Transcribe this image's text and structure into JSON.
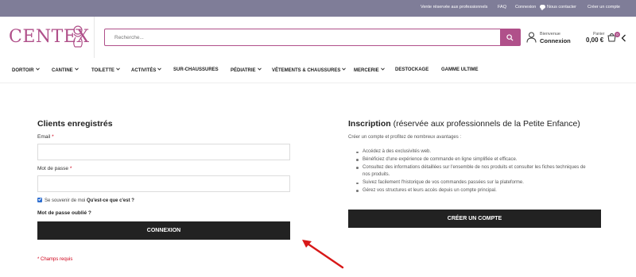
{
  "topbar": {
    "links": [
      "Vente réservée aux professionnels",
      "FAQ",
      "Connexion",
      "Nous contacter",
      "Créer un compte"
    ]
  },
  "header": {
    "logo_text": "CENTEX",
    "search_placeholder": "Recherche...",
    "user_greeting": "Bienvenue",
    "user_action": "Connexion",
    "cart_label": "Panier",
    "cart_total": "0,00 €",
    "cart_count": "0"
  },
  "nav": {
    "items": [
      "DORTOIR",
      "CANTINE",
      "TOILETTE",
      "ACTIVITÉS",
      "SUR-CHAUSSURES",
      "PÉDIATRIE",
      "VÊTEMENTS & CHAUSSURES",
      "MERCERIE",
      "DESTOCKAGE",
      "GAMME ULTIME"
    ]
  },
  "login": {
    "title": "Clients enregistrés",
    "email_label": "Email",
    "password_label": "Mot de passe",
    "required_star": "*",
    "remember_label": "Se souvenir de moi",
    "remember_help": "Qu'est-ce que c'est ?",
    "forgot_label": "Mot de passe oublié ?",
    "submit_label": "CONNEXION",
    "required_note": "* Champs requis"
  },
  "register": {
    "title_bold": "Inscription",
    "title_rest": " (réservée aux professionnels de la Petite Enfance)",
    "intro": "Créer un compte et profitez de nombreux avantages :",
    "benefits": [
      "Accédez à des exclusivités web.",
      "Bénéficiez d'une expérience de commande en ligne simplifiée et efficace.",
      "Consultez des informations détaillées sur l'ensemble de nos produits et consulter les fiches techniques de nos produits.",
      "Suivez facilement l'historique de vos commandes passées sur la plateforme.",
      "Gérez vos structures et leurs accès depuis un compte principal."
    ],
    "button_label": "CRÉER UN COMPTE"
  },
  "colors": {
    "brand": "#b0508a",
    "topbar": "#7f7d98",
    "button": "#222222",
    "required": "#d0021b",
    "annotation_arrow": "#d81818"
  }
}
